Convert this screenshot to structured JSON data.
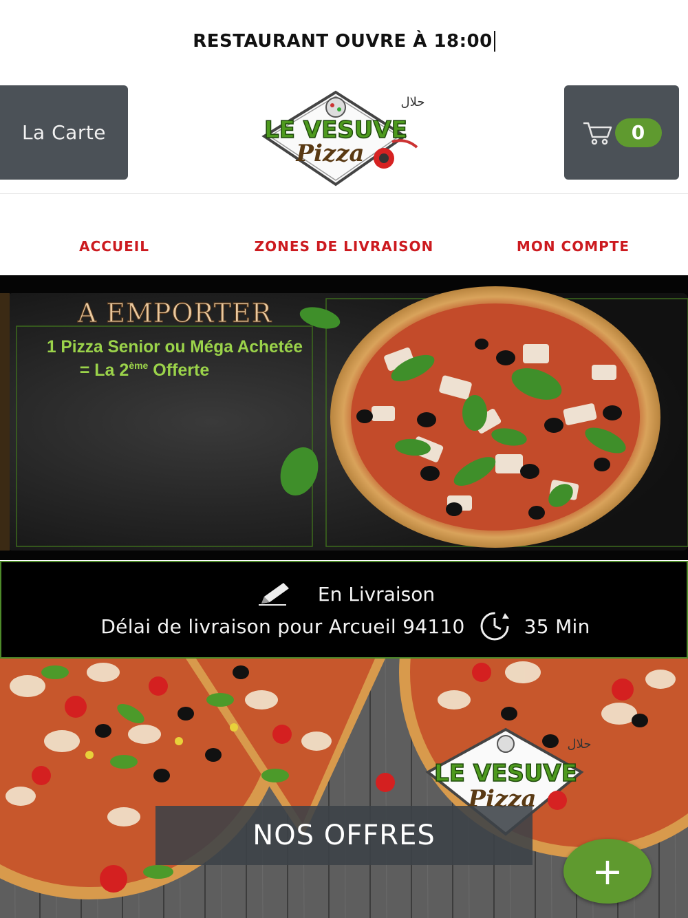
{
  "status": {
    "text": "RESTAURANT OUVRE À 18:00"
  },
  "header": {
    "carte_label": "La Carte",
    "cart_count": "0",
    "logo_top": "LE VESUVE",
    "logo_bottom": "Pizza",
    "logo_halal": "حلال"
  },
  "nav": {
    "items": [
      {
        "label": "ACCUEIL"
      },
      {
        "label": "ZONES DE LIVRAISON"
      },
      {
        "label": "MON COMPTE"
      }
    ]
  },
  "banner": {
    "title": "A EMPORTER",
    "line1": "1 Pizza Senior ou Méga Achetée",
    "line2_prefix": "= La 2",
    "line2_sup": "ème",
    "line2_suffix": " Offerte"
  },
  "delivery": {
    "mode": "En Livraison",
    "delay_text": "Délai de livraison pour Arcueil 94110",
    "time": "35 Min"
  },
  "hero": {
    "offres_label": "NOS OFFRES",
    "fab_label": "+"
  },
  "colors": {
    "accent_red": "#cc1a1f",
    "accent_green": "#5f9a2f",
    "dark_button": "#4b5157"
  }
}
